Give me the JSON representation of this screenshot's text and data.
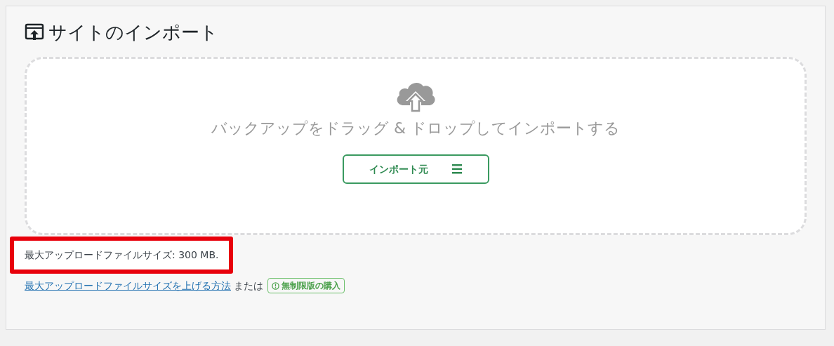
{
  "panel": {
    "title": "サイトのインポート"
  },
  "dropzone": {
    "message": "バックアップをドラッグ & ドロップしてインポートする",
    "button": "インポート元"
  },
  "max_size": {
    "text": "最大アップロードファイルサイズ: 300 MB.",
    "highlighted": true
  },
  "help": {
    "link": "最大アップロードファイルサイズを上げる方法",
    "separator": "または",
    "badge": "無制限版の購入"
  }
}
